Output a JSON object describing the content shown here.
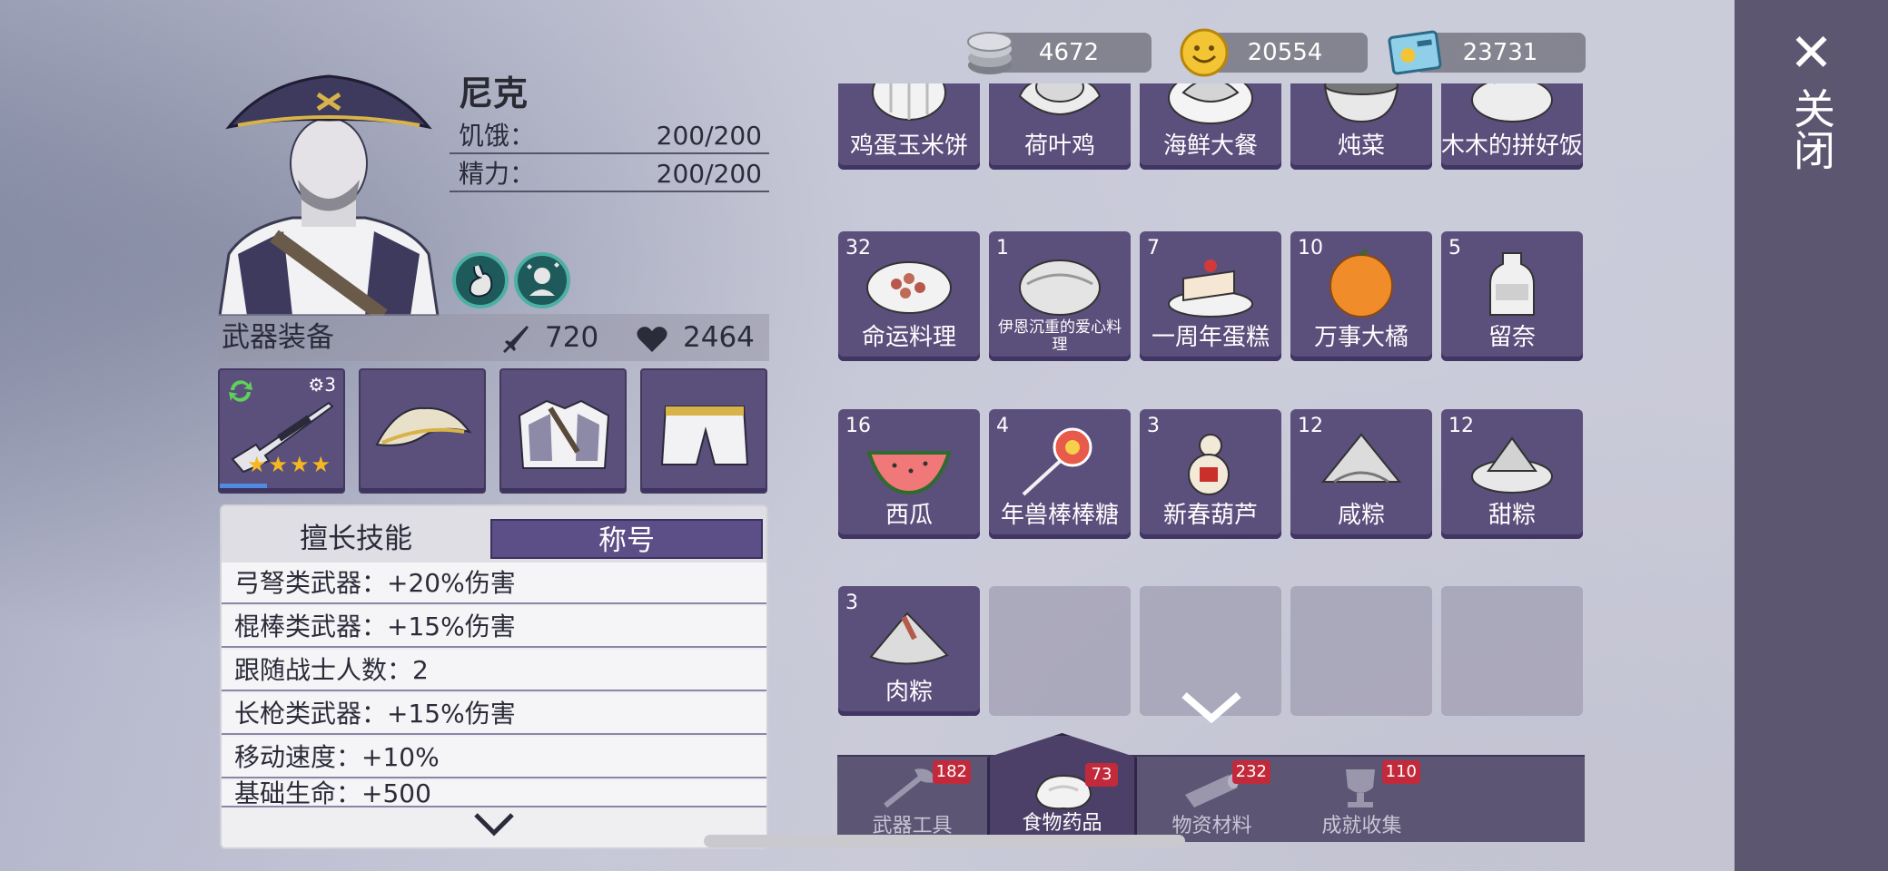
{
  "currencies": [
    {
      "icon": "silver-coin-icon",
      "value": "4672"
    },
    {
      "icon": "gold-coin-icon",
      "value": "20554"
    },
    {
      "icon": "ticket-icon",
      "value": "23731"
    }
  ],
  "close": {
    "icon": "close-icon",
    "label": "关闭"
  },
  "hero": {
    "name": "尼克",
    "stats": [
      {
        "label": "饥饿：",
        "value": "200/200"
      },
      {
        "label": "精力：",
        "value": "200/200"
      }
    ],
    "badges": [
      "stomach-badge-icon",
      "spirit-badge-icon"
    ]
  },
  "equipment": {
    "title": "武器装备",
    "attack": "720",
    "health": "2464",
    "weapon_level": "3",
    "weapon_stars": "★★★★",
    "exp_fraction": 0.38,
    "slots": [
      "sniper-rifle-icon",
      "pirate-hat-icon",
      "coat-icon",
      "pants-icon"
    ]
  },
  "skills": {
    "tab_skills": "擅长技能",
    "tab_title": "称号",
    "rows": [
      "弓弩类武器：+20%伤害",
      "棍棒类武器：+15%伤害",
      "跟随战士人数：2",
      "长枪类武器：+15%伤害",
      "移动速度：+10%",
      "基础生命：+500"
    ]
  },
  "inventory": {
    "items": [
      {
        "name": "鸡蛋玉米饼",
        "count": ""
      },
      {
        "name": "荷叶鸡",
        "count": ""
      },
      {
        "name": "海鲜大餐",
        "count": ""
      },
      {
        "name": "炖菜",
        "count": ""
      },
      {
        "name": "木木的拼好饭",
        "count": ""
      },
      {
        "name": "命运料理",
        "count": "32"
      },
      {
        "name": "伊恩沉重的爱心料理",
        "count": "1"
      },
      {
        "name": "一周年蛋糕",
        "count": "7"
      },
      {
        "name": "万事大橘",
        "count": "10"
      },
      {
        "name": "留奈",
        "count": "5"
      },
      {
        "name": "西瓜",
        "count": "16"
      },
      {
        "name": "年兽棒棒糖",
        "count": "4"
      },
      {
        "name": "新春葫芦",
        "count": "3"
      },
      {
        "name": "咸粽",
        "count": "12"
      },
      {
        "name": "甜粽",
        "count": "12"
      },
      {
        "name": "肉粽",
        "count": "3"
      }
    ]
  },
  "tabs": [
    {
      "label": "武器工具",
      "badge": "182",
      "icon": "axe-icon"
    },
    {
      "label": "食物药品",
      "badge": "73",
      "icon": "meat-icon",
      "active": true
    },
    {
      "label": "物资材料",
      "badge": "232",
      "icon": "log-icon"
    },
    {
      "label": "成就收集",
      "badge": "110",
      "icon": "trophy-icon"
    }
  ]
}
